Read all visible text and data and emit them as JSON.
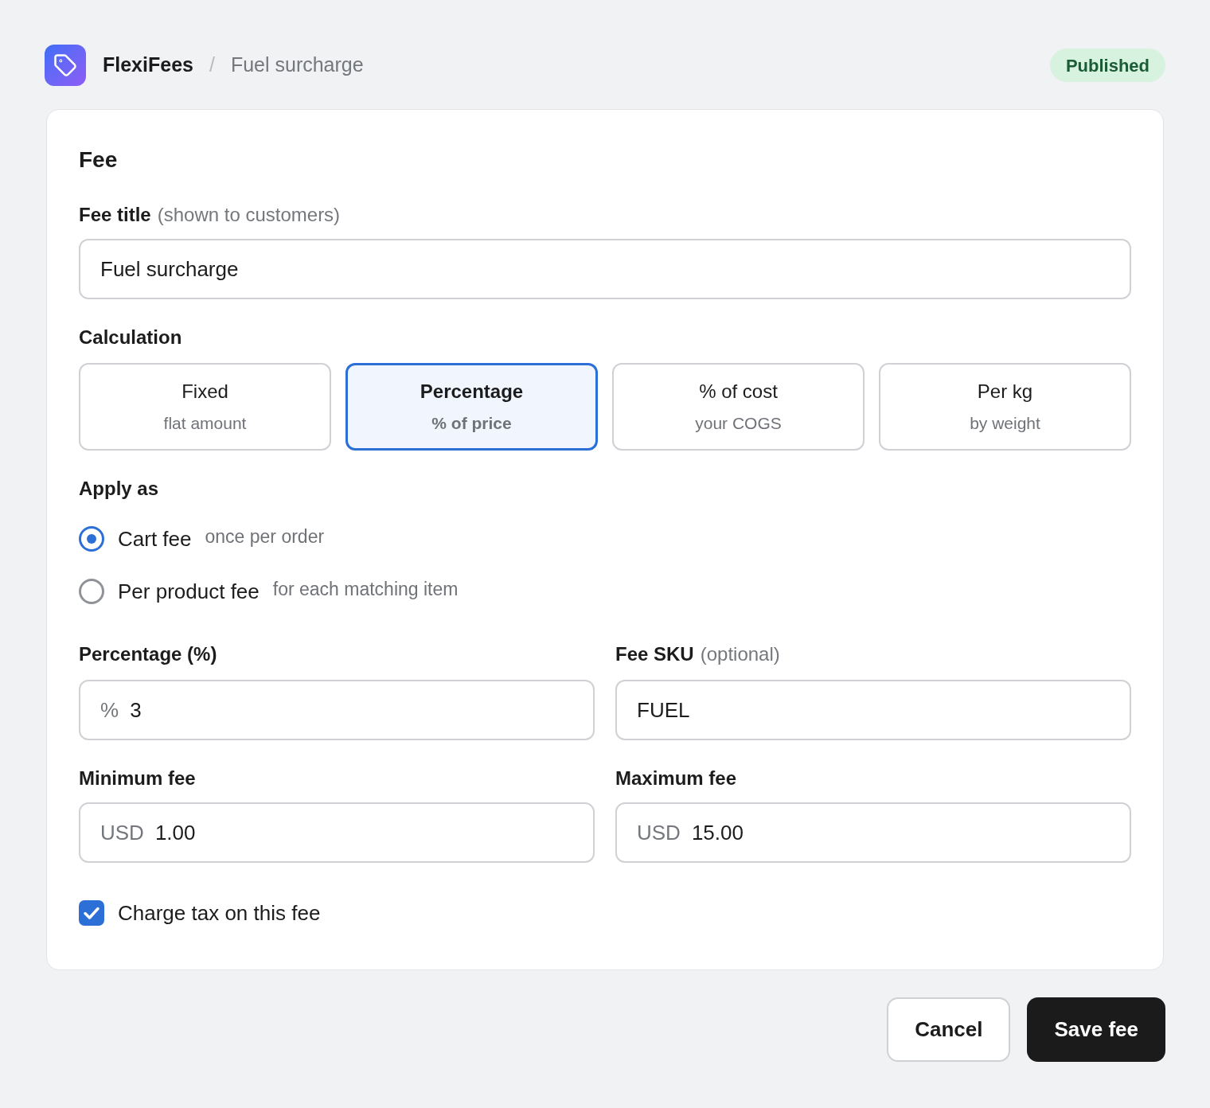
{
  "header": {
    "app_name": "FlexiFees",
    "separator": "/",
    "page_title": "Fuel surcharge",
    "status": "Published"
  },
  "card": {
    "heading": "Fee",
    "fee_title": {
      "label": "Fee title",
      "hint": "(shown to customers)",
      "value": "Fuel surcharge"
    },
    "calculation": {
      "label": "Calculation",
      "options": [
        {
          "title": "Fixed",
          "subtitle": "flat amount",
          "selected": false
        },
        {
          "title": "Percentage",
          "subtitle": "% of price",
          "selected": true
        },
        {
          "title": "% of cost",
          "subtitle": "your COGS",
          "selected": false
        },
        {
          "title": "Per kg",
          "subtitle": "by weight",
          "selected": false
        }
      ]
    },
    "apply_as": {
      "label": "Apply as",
      "options": [
        {
          "label": "Cart fee",
          "description": "once per order",
          "selected": true
        },
        {
          "label": "Per product fee",
          "description": "for each matching item",
          "selected": false
        }
      ]
    },
    "fields": [
      {
        "label": "Percentage (%)",
        "prefix": "%",
        "value": "3"
      },
      {
        "label": "Fee SKU",
        "hint": "(optional)",
        "value": "FUEL"
      },
      {
        "label": "Minimum fee",
        "prefix": "USD",
        "value": "1.00"
      },
      {
        "label": "Maximum fee",
        "prefix": "USD",
        "value": "15.00"
      }
    ],
    "tax": {
      "label": "Charge tax on this fee",
      "checked": true
    }
  },
  "actions": [
    {
      "label": "Cancel",
      "kind": "secondary"
    },
    {
      "label": "Save fee",
      "kind": "primary"
    }
  ]
}
